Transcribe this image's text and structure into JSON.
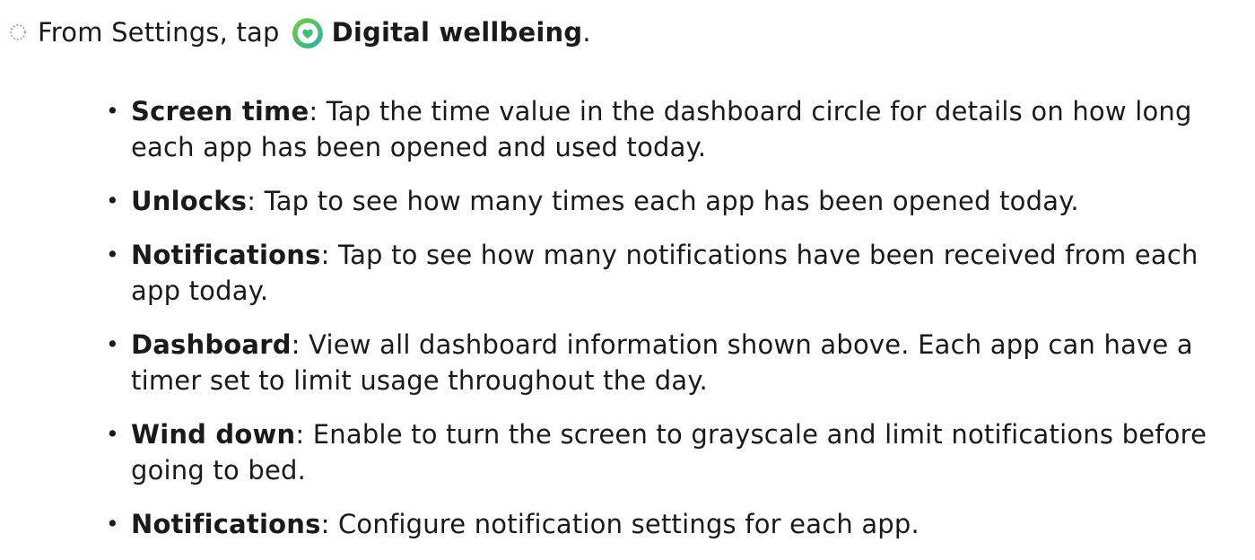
{
  "step": {
    "prefix": "From Settings, tap",
    "app_name": "Digital wellbeing",
    "suffix": ".",
    "icon": "digital-wellbeing-icon",
    "marker_icon": "dotted-circle-icon"
  },
  "bullets": [
    {
      "term": "Screen time",
      "text": ": Tap the time value in the dashboard circle for details on how long each app has been opened and used today."
    },
    {
      "term": "Unlocks",
      "text": ": Tap to see how many times each app has been opened today."
    },
    {
      "term": "Notifications",
      "text": ": Tap to see how many notifications have been received from each app today."
    },
    {
      "term": "Dashboard",
      "text": ": View all dashboard information shown above. Each app can have a timer set to limit usage throughout the day."
    },
    {
      "term": "Wind down",
      "text": ": Enable to turn the screen to grayscale and limit notifications before going to bed."
    },
    {
      "term": "Notifications",
      "text": ": Configure notification settings for each app."
    }
  ],
  "colors": {
    "text": "#1a1a1a",
    "icon_green": "#5cbf3a",
    "icon_teal": "#2fb5a6"
  }
}
